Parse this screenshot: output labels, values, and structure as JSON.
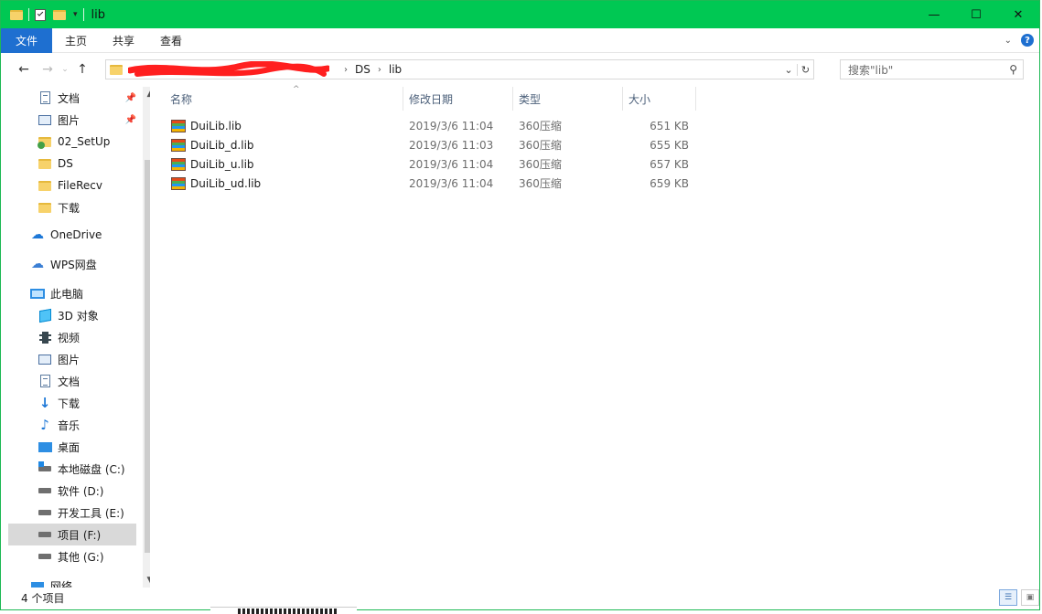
{
  "window": {
    "title": "lib",
    "controls": [
      "—",
      "☐",
      "✕"
    ]
  },
  "ribbon": {
    "tabs": [
      "文件",
      "主页",
      "共享",
      "查看"
    ]
  },
  "address": {
    "crumbs": [
      "DS",
      "lib"
    ],
    "search_placeholder": "搜索\"lib\""
  },
  "sidebar": {
    "items": [
      {
        "label": "文档",
        "icon": "document-icon",
        "pinned": true
      },
      {
        "label": "图片",
        "icon": "picture-icon",
        "pinned": true
      },
      {
        "label": "02_SetUp",
        "icon": "folder-sync-icon"
      },
      {
        "label": "DS",
        "icon": "folder-icon"
      },
      {
        "label": "FileRecv",
        "icon": "folder-icon"
      },
      {
        "label": "下载",
        "icon": "folder-icon"
      },
      {
        "label": "OneDrive",
        "icon": "cloud-icon"
      },
      {
        "label": "WPS网盘",
        "icon": "cloud-outline-icon"
      },
      {
        "label": "此电脑",
        "icon": "computer-icon"
      },
      {
        "label": "3D 对象",
        "icon": "cube-icon"
      },
      {
        "label": "视频",
        "icon": "video-icon"
      },
      {
        "label": "图片",
        "icon": "picture-icon"
      },
      {
        "label": "文档",
        "icon": "document-icon"
      },
      {
        "label": "下载",
        "icon": "download-arrow-icon"
      },
      {
        "label": "音乐",
        "icon": "music-note-icon"
      },
      {
        "label": "桌面",
        "icon": "desktop-icon"
      },
      {
        "label": "本地磁盘 (C:)",
        "icon": "system-drive-icon"
      },
      {
        "label": "软件 (D:)",
        "icon": "drive-icon"
      },
      {
        "label": "开发工具 (E:)",
        "icon": "drive-icon"
      },
      {
        "label": "项目 (F:)",
        "icon": "drive-icon",
        "selected": true
      },
      {
        "label": "其他 (G:)",
        "icon": "drive-icon"
      },
      {
        "label": "网络",
        "icon": "network-icon"
      }
    ]
  },
  "columns": [
    "名称",
    "修改日期",
    "类型",
    "大小"
  ],
  "files": [
    {
      "name": "DuiLib.lib",
      "date": "2019/3/6 11:04",
      "type": "360压缩",
      "size": "651 KB"
    },
    {
      "name": "DuiLib_d.lib",
      "date": "2019/3/6 11:03",
      "type": "360压缩",
      "size": "655 KB"
    },
    {
      "name": "DuiLib_u.lib",
      "date": "2019/3/6 11:04",
      "type": "360压缩",
      "size": "657 KB"
    },
    {
      "name": "DuiLib_ud.lib",
      "date": "2019/3/6 11:04",
      "type": "360压缩",
      "size": "659 KB"
    }
  ],
  "status": {
    "item_count": "4 个项目"
  },
  "colors": {
    "titlebar": "#00c853",
    "file_tab": "#1e6fd0",
    "selection": "#d9d9d9"
  }
}
